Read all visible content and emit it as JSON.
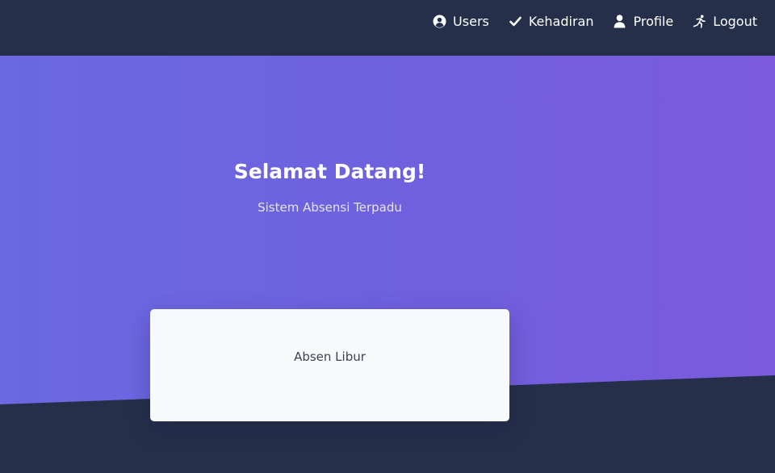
{
  "navbar": {
    "items": [
      {
        "label": "Users",
        "icon": "user-circle-icon"
      },
      {
        "label": "Kehadiran",
        "icon": "checkmark-icon"
      },
      {
        "label": "Profile",
        "icon": "user-icon"
      },
      {
        "label": "Logout",
        "icon": "running-person-icon"
      }
    ]
  },
  "hero": {
    "title": "Selamat Datang!",
    "subtitle": "Sistem Absensi Terpadu"
  },
  "card": {
    "text": "Absen Libur"
  },
  "colors": {
    "navbar_background": "#252f4a",
    "hero_gradient_start": "#6a69e1",
    "hero_gradient_end": "#7a5bdd",
    "card_background": "#f8f9fb",
    "text_white": "#ffffff"
  }
}
